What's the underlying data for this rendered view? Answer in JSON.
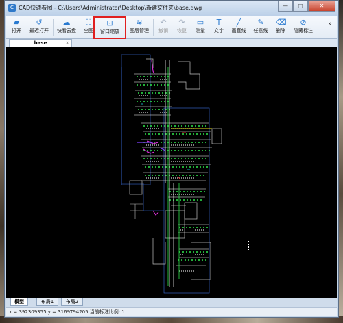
{
  "window": {
    "title": "CAD快速看图 - C:\\Users\\Administrator\\Desktop\\新建文件夹\\base.dwg",
    "min_label": "—",
    "max_label": "▢",
    "close_label": "✕"
  },
  "toolbar": {
    "items": [
      {
        "label": "打开",
        "icon": "folder-icon"
      },
      {
        "label": "最近打开",
        "icon": "recent-icon"
      },
      {
        "label": "快看云盘",
        "icon": "cloud-icon"
      },
      {
        "label": "全图",
        "icon": "fullview-icon"
      },
      {
        "label": "窗口缩放",
        "icon": "window-zoom-icon"
      },
      {
        "label": "图层管理",
        "icon": "layers-icon"
      },
      {
        "label": "撤销",
        "icon": "undo-icon"
      },
      {
        "label": "恢复",
        "icon": "redo-icon"
      },
      {
        "label": "测量",
        "icon": "measure-icon"
      },
      {
        "label": "文字",
        "icon": "text-icon"
      },
      {
        "label": "画直线",
        "icon": "line-icon"
      },
      {
        "label": "任意线",
        "icon": "pencil-icon"
      },
      {
        "label": "删除",
        "icon": "eraser-icon"
      },
      {
        "label": "隐藏标注",
        "icon": "hide-icon"
      }
    ],
    "more_label": "»"
  },
  "document": {
    "tab_label": "base",
    "tab_close": "×"
  },
  "layout_tabs": [
    "模型",
    "布局1",
    "布局2"
  ],
  "status": {
    "text": "x = 392309355 y = 3169T94205 当前标注比例: 1"
  },
  "colors": {
    "accent": "#2a7ad0",
    "highlight": "#e02020",
    "canvas": "#000000"
  }
}
